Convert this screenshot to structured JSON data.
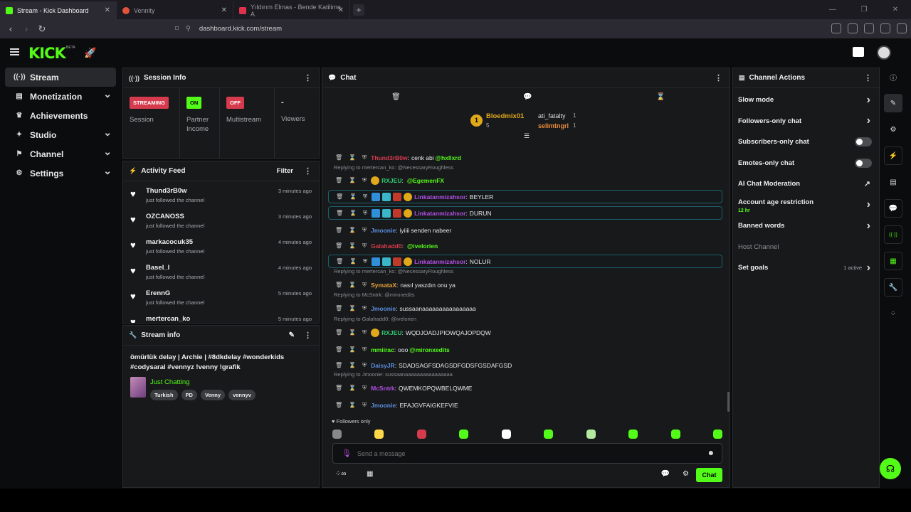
{
  "browser": {
    "tabs": [
      {
        "title": "Stream - Kick Dashboard",
        "color": "#53fc18"
      },
      {
        "title": "Vennity",
        "color": "#e2533a"
      },
      {
        "title": "Yıldırım Elmas - Bende Katilime A",
        "color": "#e0314b"
      }
    ],
    "url": "dashboard.kick.com/stream"
  },
  "topbar": {
    "logo": "KICK",
    "logo_badge": "BETA"
  },
  "sidebar": {
    "items": [
      {
        "label": "Stream",
        "icon": "broadcast-icon",
        "glyph": "((·))",
        "chevron": false
      },
      {
        "label": "Monetization",
        "icon": "wallet-icon",
        "glyph": "▤",
        "chevron": true
      },
      {
        "label": "Achievements",
        "icon": "trophy-icon",
        "glyph": "♛",
        "chevron": false
      },
      {
        "label": "Studio",
        "icon": "studio-icon",
        "glyph": "✦",
        "chevron": true
      },
      {
        "label": "Channel",
        "icon": "channel-icon",
        "glyph": "⚑",
        "chevron": true
      },
      {
        "label": "Settings",
        "icon": "gear-icon",
        "glyph": "⚙",
        "chevron": true
      }
    ]
  },
  "session_info": {
    "title": "Session Info",
    "cells": [
      {
        "badge": "STREAMING",
        "badge_style": "red",
        "label": "Session"
      },
      {
        "badge": "ON",
        "badge_style": "green",
        "label": "Partner\nIncome"
      },
      {
        "badge": "OFF",
        "badge_style": "red",
        "label": "Multistream"
      },
      {
        "badge": "-",
        "badge_style": "none",
        "label": "Viewers"
      }
    ]
  },
  "activity_feed": {
    "title": "Activity Feed",
    "filter_label": "Filter",
    "items": [
      {
        "name": "Thund3rB0w",
        "action": "just followed the channel",
        "time": "3 minutes ago"
      },
      {
        "name": "OZCANOSS",
        "action": "just followed the channel",
        "time": "3 minutes ago"
      },
      {
        "name": "markacocuk35",
        "action": "just followed the channel",
        "time": "4 minutes ago"
      },
      {
        "name": "Basel_l",
        "action": "just followed the channel",
        "time": "4 minutes ago"
      },
      {
        "name": "ErennG",
        "action": "just followed the channel",
        "time": "5 minutes ago"
      },
      {
        "name": "mertercan_ko",
        "action": "",
        "time": "5 minutes ago"
      }
    ]
  },
  "stream_info": {
    "title": "Stream info",
    "stream_title": "ömürlük delay | Archie | #8dkdelay #wonderkids #codysaral #vennyz !venny !grafik",
    "category": "Just Chatting",
    "tags": [
      "Turkish",
      "PD",
      "Venny",
      "vennyv"
    ]
  },
  "chat": {
    "title": "Chat",
    "pinned": {
      "top_gifter": "Bloedmix01",
      "top_gifter_count": "5",
      "gifters": [
        {
          "name": "ati_fatalty",
          "count": "1"
        },
        {
          "name": "selimtngrl",
          "count": "1"
        }
      ]
    },
    "messages": [
      {
        "type": "msg",
        "user": "Thund3rB0w",
        "color": "#d63b4d",
        "text": "@hxllxrd cenk abi",
        "mention": "@hxllxrd",
        "body": " cenk abi",
        "rank": false,
        "hl": false,
        "badges": 0
      },
      {
        "type": "reply",
        "text": "Replying to mertercan_ko: @NecessaryRoughless"
      },
      {
        "type": "msg",
        "user": "RXJEU",
        "color": "#2ecc71",
        "mention": "@EgemenFX",
        "body": "",
        "rank": true,
        "hl": false,
        "badges": 0
      },
      {
        "type": "msg",
        "user": "Linkatanmizahsor",
        "color": "#b34de5",
        "mention": "",
        "body": "BEYLER",
        "rank": true,
        "hl": true,
        "badges": 3
      },
      {
        "type": "msg",
        "user": "Linkatanmizahsor",
        "color": "#b34de5",
        "mention": "",
        "body": "DURUN",
        "rank": true,
        "hl": true,
        "badges": 3
      },
      {
        "type": "msg",
        "user": "Jmoonie",
        "color": "#5b8fe0",
        "mention": "",
        "body": "iyiiii senden nabeer",
        "rank": false,
        "hl": false,
        "badges": 0
      },
      {
        "type": "msg",
        "user": "Galahadd0",
        "color": "#d63b4d",
        "mention": "@ivelorien",
        "body": "",
        "rank": false,
        "hl": false,
        "badges": 0
      },
      {
        "type": "msg",
        "user": "Linkatanmizahsor",
        "color": "#b34de5",
        "mention": "",
        "body": "NOLUR",
        "rank": true,
        "hl": true,
        "badges": 3
      },
      {
        "type": "reply",
        "text": "Replying to mertercan_ko: @NecessaryRoughless"
      },
      {
        "type": "msg",
        "user": "SymataX",
        "color": "#e6a23c",
        "mention": "",
        "body": "nasıl yaszdın onu ya",
        "rank": false,
        "hl": false,
        "badges": 0
      },
      {
        "type": "reply",
        "text": "Replying to McSntrk: @mironedits"
      },
      {
        "type": "msg",
        "user": "Jmoonie",
        "color": "#5b8fe0",
        "mention": "",
        "body": "sussaanaaaaaaaaaaaaaaaa",
        "rank": false,
        "hl": false,
        "badges": 0
      },
      {
        "type": "reply",
        "text": "Replying to Galahadd0: @ivelorien"
      },
      {
        "type": "msg",
        "user": "RXJEU",
        "color": "#2ecc71",
        "mention": "",
        "body": "WQDJOADJPIOWQAJOPDQW",
        "rank": true,
        "hl": false,
        "badges": 0
      },
      {
        "type": "msg",
        "user": "mmiirac",
        "color": "#53fc18",
        "mention": "@mironxedits",
        "body": "ooo ",
        "rank": false,
        "hl": false,
        "badges": 0
      },
      {
        "type": "msg",
        "user": "DaisyJR",
        "color": "#5b8fe0",
        "mention": "",
        "body": "SDADSAGFSDAGSDFGDSFGSDAFGSD",
        "rank": false,
        "hl": false,
        "badges": 0
      },
      {
        "type": "reply",
        "text": "Replying to Jmoonie: sussaanaaaaaaaaaaaaaaaa"
      },
      {
        "type": "msg",
        "user": "McSntrk",
        "color": "#b34de5",
        "mention": "",
        "body": "QWEMKOPQWBELQWME",
        "rank": false,
        "hl": false,
        "badges": 0
      },
      {
        "type": "msg",
        "user": "Jmoonie",
        "color": "#5b8fe0",
        "mention": "",
        "body": "EFAJGVFAIGKEFVIE",
        "rank": false,
        "hl": false,
        "badges": 0
      }
    ],
    "followers_only": "Followers only",
    "input_placeholder": "Send a message",
    "send_label": "Chat",
    "emote_colors": [
      "#888888",
      "#ffd84a",
      "#d63b4d",
      "#53fc18",
      "#ffffff",
      "#53fc18",
      "#b3e9a0",
      "#53fc18",
      "#53fc18",
      "#53fc18"
    ]
  },
  "channel_actions": {
    "title": "Channel Actions",
    "items": [
      {
        "label": "Slow mode",
        "kind": "chevron",
        "sub": "",
        "extra": ""
      },
      {
        "label": "Followers-only chat",
        "kind": "chevron",
        "sub": "",
        "extra": ""
      },
      {
        "label": "Subscribers-only chat",
        "kind": "toggle",
        "sub": "",
        "extra": ""
      },
      {
        "label": "Emotes-only chat",
        "kind": "toggle",
        "sub": "",
        "extra": ""
      },
      {
        "label": "AI Chat Moderation",
        "kind": "external",
        "sub": "",
        "extra": ""
      },
      {
        "label": "Account age restriction",
        "kind": "chevron",
        "sub": "12 hr",
        "extra": ""
      },
      {
        "label": "Banned words",
        "kind": "chevron",
        "sub": "",
        "extra": ""
      },
      {
        "label": "Host Channel",
        "kind": "disabled",
        "sub": "",
        "extra": ""
      },
      {
        "label": "Set goals",
        "kind": "chevron",
        "sub": "",
        "extra": "1 active"
      }
    ]
  },
  "rail": {
    "buttons": [
      {
        "icon": "info-icon",
        "glyph": "ⓘ",
        "style": "plain"
      },
      {
        "icon": "pencil-icon",
        "glyph": "✎",
        "style": "sel"
      },
      {
        "icon": "settings-icon",
        "glyph": "⚙",
        "style": "plain"
      },
      {
        "icon": "bolt-icon",
        "glyph": "⚡",
        "style": "green"
      },
      {
        "icon": "document-icon",
        "glyph": "▤",
        "style": "plain"
      },
      {
        "icon": "chat-icon",
        "glyph": "💬",
        "style": "green"
      },
      {
        "icon": "broadcast-icon",
        "glyph": "((·))",
        "style": "green"
      },
      {
        "icon": "layout-icon",
        "glyph": "▦",
        "style": "green"
      },
      {
        "icon": "wrench-icon",
        "glyph": "🔧",
        "style": "green"
      },
      {
        "icon": "dots-icon",
        "glyph": "⁘",
        "style": "plain"
      }
    ]
  }
}
